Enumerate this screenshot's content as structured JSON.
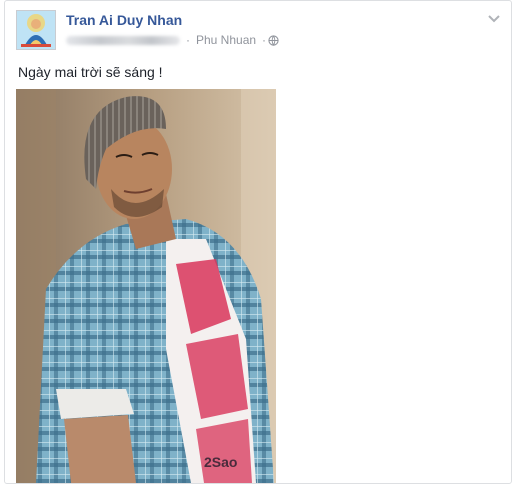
{
  "post": {
    "author": "Tran Ai Duy Nhan",
    "location": "Phu Nhuan",
    "separator": "·",
    "status_text": "Ngày mai trời sẽ sáng !",
    "privacy_icon": "globe-icon",
    "options_icon": "chevron-down-icon",
    "watermark": "2Sao"
  },
  "colors": {
    "author_link": "#365899",
    "meta_text": "#90949c",
    "border": "#dddfe2"
  }
}
